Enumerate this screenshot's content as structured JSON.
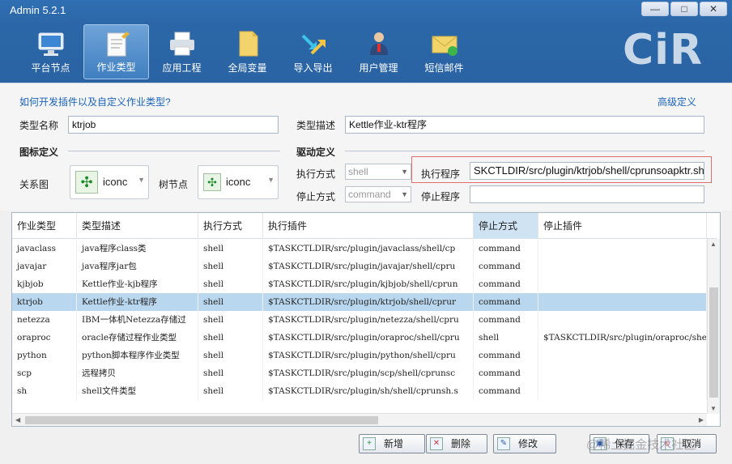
{
  "window": {
    "title": "Admin 5.2.1",
    "controls": [
      "—",
      "□",
      "✕"
    ]
  },
  "toolbar": [
    {
      "label": "平台节点",
      "icon": "monitor-icon"
    },
    {
      "label": "作业类型",
      "icon": "notepad-pencil-icon",
      "active": true
    },
    {
      "label": "应用工程",
      "icon": "printer-icon"
    },
    {
      "label": "全局变量",
      "icon": "document-icon"
    },
    {
      "label": "导入导出",
      "icon": "import-export-arrows-icon"
    },
    {
      "label": "用户管理",
      "icon": "user-manager-icon"
    },
    {
      "label": "短信邮件",
      "icon": "envelope-icon"
    }
  ],
  "logo_text": "CiR",
  "form": {
    "help_link": "如何开发插件以及自定义作业类型?",
    "advanced_link": "高级定义",
    "type_name_label": "类型名称",
    "type_name_value": "ktrjob",
    "type_desc_label": "类型描述",
    "type_desc_value": "Kettle作业-ktr程序",
    "icon_section": "图标定义",
    "driver_section": "驱动定义",
    "relation_label": "关系图",
    "relation_icon": "iconc",
    "tree_label": "树节点",
    "tree_icon": "iconc",
    "exec_mode_label": "执行方式",
    "exec_mode_value": "shell",
    "exec_program_label": "执行程序",
    "exec_program_value": "SKCTLDIR/src/plugin/ktrjob/shell/cprunsoapktr.sh",
    "stop_mode_label": "停止方式",
    "stop_mode_value": "command",
    "stop_program_label": "停止程序",
    "stop_program_value": ""
  },
  "table": {
    "headers": [
      "作业类型",
      "类型描述",
      "执行方式",
      "执行插件",
      "停止方式",
      "停止插件"
    ],
    "rows": [
      [
        "javaclass",
        "java程序class类",
        "shell",
        "$TASKCTLDIR/src/plugin/javaclass/shell/cp",
        "command",
        ""
      ],
      [
        "javajar",
        "java程序jar包",
        "shell",
        "$TASKCTLDIR/src/plugin/javajar/shell/cpru",
        "command",
        ""
      ],
      [
        "kjbjob",
        "Kettle作业-kjb程序",
        "shell",
        "$TASKCTLDIR/src/plugin/kjbjob/shell/cprun",
        "command",
        ""
      ],
      [
        "ktrjob",
        "Kettle作业-ktr程序",
        "shell",
        "$TASKCTLDIR/src/plugin/ktrjob/shell/cprur",
        "command",
        ""
      ],
      [
        "netezza",
        "IBM一体机Netezza存储过",
        "shell",
        "$TASKCTLDIR/src/plugin/netezza/shell/cpru",
        "command",
        ""
      ],
      [
        "oraproc",
        "oracle存储过程作业类型",
        "shell",
        "$TASKCTLDIR/src/plugin/oraproc/shell/cpru",
        "shell",
        "$TASKCTLDIR/src/plugin/oraproc/she"
      ],
      [
        "python",
        "python脚本程序作业类型",
        "shell",
        "$TASKCTLDIR/src/plugin/python/shell/cpru",
        "command",
        ""
      ],
      [
        "scp",
        "远程拷贝",
        "shell",
        "$TASKCTLDIR/src/plugin/scp/shell/cprunsc",
        "command",
        ""
      ],
      [
        "sh",
        "shell文件类型",
        "shell",
        "$TASKCTLDIR/src/plugin/sh/shell/cprunsh.s",
        "command",
        ""
      ]
    ],
    "selected_row": 3
  },
  "buttons": {
    "add": "新增",
    "delete": "删除",
    "modify": "修改",
    "save": "保存",
    "cancel": "取消"
  },
  "watermark": "@稀土掘金技术社区"
}
